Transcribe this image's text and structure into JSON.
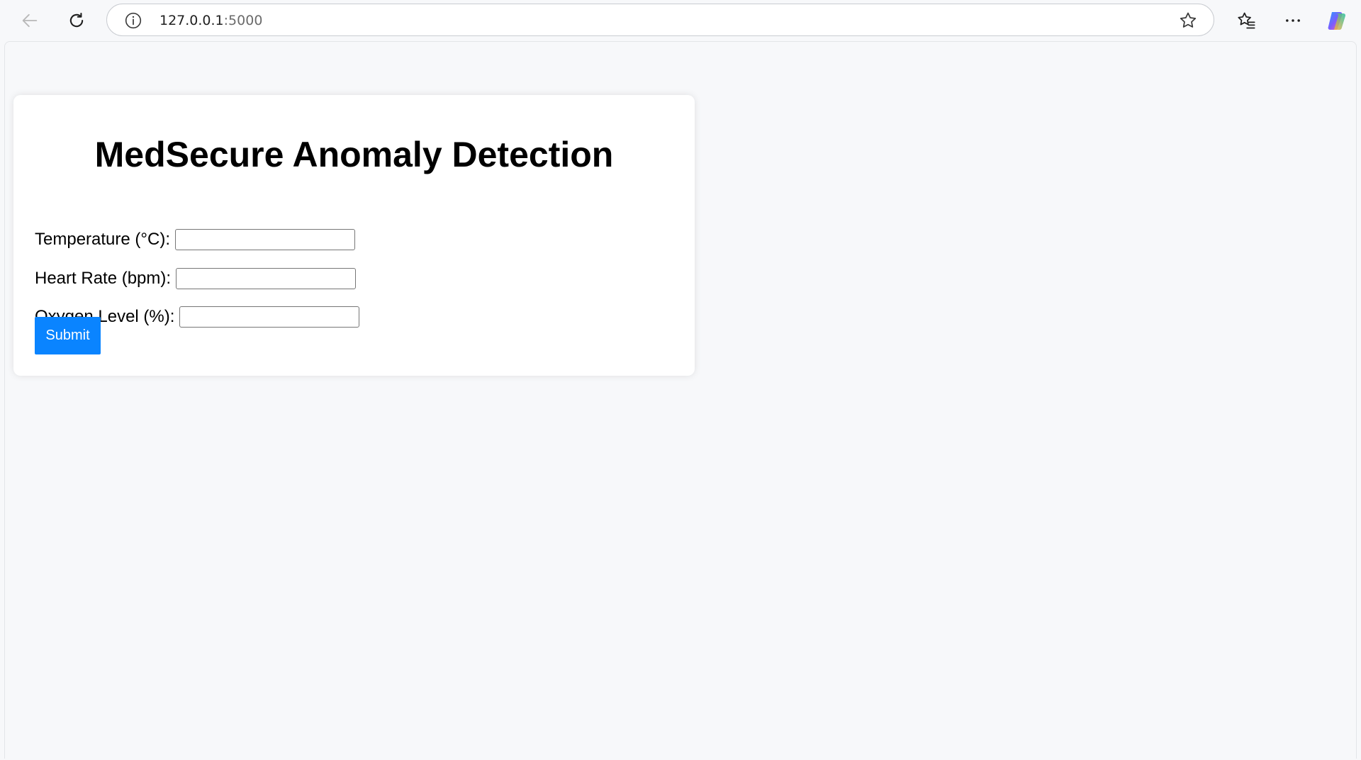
{
  "browser": {
    "url_host": "127.0.0.1",
    "url_port": ":5000",
    "icons": {
      "back": "back-arrow-icon",
      "reload": "reload-icon",
      "info": "info-icon",
      "favorite": "star-icon",
      "favorites_list": "favorites-icon",
      "menu": "more-icon",
      "copilot": "copilot-icon"
    }
  },
  "page": {
    "title": "MedSecure Anomaly Detection",
    "fields": [
      {
        "label": "Temperature (°C):",
        "value": ""
      },
      {
        "label": "Heart Rate (bpm):",
        "value": ""
      },
      {
        "label": "Oxygen Level (%):",
        "value": ""
      }
    ],
    "submit_label": "Submit",
    "colors": {
      "accent": "#0a84ff",
      "background": "#f7f8fa",
      "card": "#ffffff"
    }
  }
}
